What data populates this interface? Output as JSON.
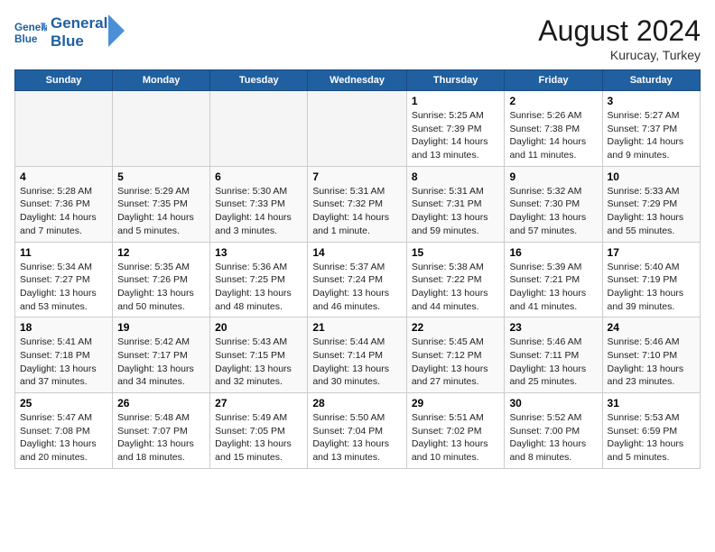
{
  "header": {
    "logo_line1": "General",
    "logo_line2": "Blue",
    "month_title": "August 2024",
    "location": "Kurucay, Turkey"
  },
  "weekdays": [
    "Sunday",
    "Monday",
    "Tuesday",
    "Wednesday",
    "Thursday",
    "Friday",
    "Saturday"
  ],
  "weeks": [
    [
      {
        "day": "",
        "info": ""
      },
      {
        "day": "",
        "info": ""
      },
      {
        "day": "",
        "info": ""
      },
      {
        "day": "",
        "info": ""
      },
      {
        "day": "1",
        "info": "Sunrise: 5:25 AM\nSunset: 7:39 PM\nDaylight: 14 hours\nand 13 minutes."
      },
      {
        "day": "2",
        "info": "Sunrise: 5:26 AM\nSunset: 7:38 PM\nDaylight: 14 hours\nand 11 minutes."
      },
      {
        "day": "3",
        "info": "Sunrise: 5:27 AM\nSunset: 7:37 PM\nDaylight: 14 hours\nand 9 minutes."
      }
    ],
    [
      {
        "day": "4",
        "info": "Sunrise: 5:28 AM\nSunset: 7:36 PM\nDaylight: 14 hours\nand 7 minutes."
      },
      {
        "day": "5",
        "info": "Sunrise: 5:29 AM\nSunset: 7:35 PM\nDaylight: 14 hours\nand 5 minutes."
      },
      {
        "day": "6",
        "info": "Sunrise: 5:30 AM\nSunset: 7:33 PM\nDaylight: 14 hours\nand 3 minutes."
      },
      {
        "day": "7",
        "info": "Sunrise: 5:31 AM\nSunset: 7:32 PM\nDaylight: 14 hours\nand 1 minute."
      },
      {
        "day": "8",
        "info": "Sunrise: 5:31 AM\nSunset: 7:31 PM\nDaylight: 13 hours\nand 59 minutes."
      },
      {
        "day": "9",
        "info": "Sunrise: 5:32 AM\nSunset: 7:30 PM\nDaylight: 13 hours\nand 57 minutes."
      },
      {
        "day": "10",
        "info": "Sunrise: 5:33 AM\nSunset: 7:29 PM\nDaylight: 13 hours\nand 55 minutes."
      }
    ],
    [
      {
        "day": "11",
        "info": "Sunrise: 5:34 AM\nSunset: 7:27 PM\nDaylight: 13 hours\nand 53 minutes."
      },
      {
        "day": "12",
        "info": "Sunrise: 5:35 AM\nSunset: 7:26 PM\nDaylight: 13 hours\nand 50 minutes."
      },
      {
        "day": "13",
        "info": "Sunrise: 5:36 AM\nSunset: 7:25 PM\nDaylight: 13 hours\nand 48 minutes."
      },
      {
        "day": "14",
        "info": "Sunrise: 5:37 AM\nSunset: 7:24 PM\nDaylight: 13 hours\nand 46 minutes."
      },
      {
        "day": "15",
        "info": "Sunrise: 5:38 AM\nSunset: 7:22 PM\nDaylight: 13 hours\nand 44 minutes."
      },
      {
        "day": "16",
        "info": "Sunrise: 5:39 AM\nSunset: 7:21 PM\nDaylight: 13 hours\nand 41 minutes."
      },
      {
        "day": "17",
        "info": "Sunrise: 5:40 AM\nSunset: 7:19 PM\nDaylight: 13 hours\nand 39 minutes."
      }
    ],
    [
      {
        "day": "18",
        "info": "Sunrise: 5:41 AM\nSunset: 7:18 PM\nDaylight: 13 hours\nand 37 minutes."
      },
      {
        "day": "19",
        "info": "Sunrise: 5:42 AM\nSunset: 7:17 PM\nDaylight: 13 hours\nand 34 minutes."
      },
      {
        "day": "20",
        "info": "Sunrise: 5:43 AM\nSunset: 7:15 PM\nDaylight: 13 hours\nand 32 minutes."
      },
      {
        "day": "21",
        "info": "Sunrise: 5:44 AM\nSunset: 7:14 PM\nDaylight: 13 hours\nand 30 minutes."
      },
      {
        "day": "22",
        "info": "Sunrise: 5:45 AM\nSunset: 7:12 PM\nDaylight: 13 hours\nand 27 minutes."
      },
      {
        "day": "23",
        "info": "Sunrise: 5:46 AM\nSunset: 7:11 PM\nDaylight: 13 hours\nand 25 minutes."
      },
      {
        "day": "24",
        "info": "Sunrise: 5:46 AM\nSunset: 7:10 PM\nDaylight: 13 hours\nand 23 minutes."
      }
    ],
    [
      {
        "day": "25",
        "info": "Sunrise: 5:47 AM\nSunset: 7:08 PM\nDaylight: 13 hours\nand 20 minutes."
      },
      {
        "day": "26",
        "info": "Sunrise: 5:48 AM\nSunset: 7:07 PM\nDaylight: 13 hours\nand 18 minutes."
      },
      {
        "day": "27",
        "info": "Sunrise: 5:49 AM\nSunset: 7:05 PM\nDaylight: 13 hours\nand 15 minutes."
      },
      {
        "day": "28",
        "info": "Sunrise: 5:50 AM\nSunset: 7:04 PM\nDaylight: 13 hours\nand 13 minutes."
      },
      {
        "day": "29",
        "info": "Sunrise: 5:51 AM\nSunset: 7:02 PM\nDaylight: 13 hours\nand 10 minutes."
      },
      {
        "day": "30",
        "info": "Sunrise: 5:52 AM\nSunset: 7:00 PM\nDaylight: 13 hours\nand 8 minutes."
      },
      {
        "day": "31",
        "info": "Sunrise: 5:53 AM\nSunset: 6:59 PM\nDaylight: 13 hours\nand 5 minutes."
      }
    ]
  ]
}
